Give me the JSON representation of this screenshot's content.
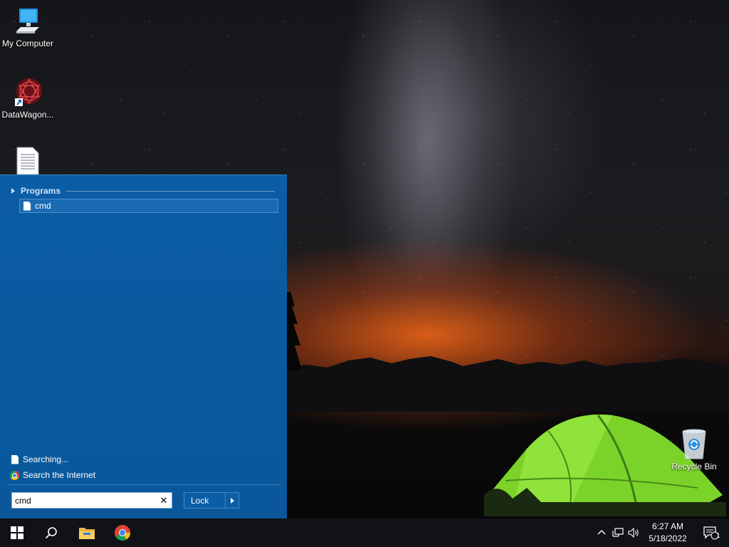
{
  "desktop": {
    "icons": [
      {
        "label": "My Computer",
        "icon": "computer-icon"
      },
      {
        "label": "DataWagon...",
        "icon": "datawagon-shortcut-icon"
      },
      {
        "label": "",
        "icon": "text-document-icon"
      },
      {
        "label": "Recycle Bin",
        "icon": "recycle-bin-icon"
      }
    ]
  },
  "start_menu": {
    "programs_header": "Programs",
    "results": [
      {
        "label": "cmd",
        "icon": "document-icon"
      }
    ],
    "searching_label": "Searching...",
    "search_internet_label": "Search the Internet",
    "search": {
      "value": "cmd",
      "clear_icon": "close-icon"
    },
    "lock_label": "Lock",
    "accent_color": "#0b5da6"
  },
  "taskbar": {
    "buttons": [
      {
        "name": "start",
        "icon": "windows-logo-icon"
      },
      {
        "name": "search",
        "icon": "search-icon"
      },
      {
        "name": "file-explorer",
        "icon": "folder-icon"
      },
      {
        "name": "chrome",
        "icon": "chrome-icon"
      }
    ],
    "tray": {
      "icons": [
        "chevron-up-icon",
        "network-icon",
        "volume-icon"
      ],
      "time": "6:27 AM",
      "date": "5/18/2022",
      "notification_count": "1"
    }
  }
}
